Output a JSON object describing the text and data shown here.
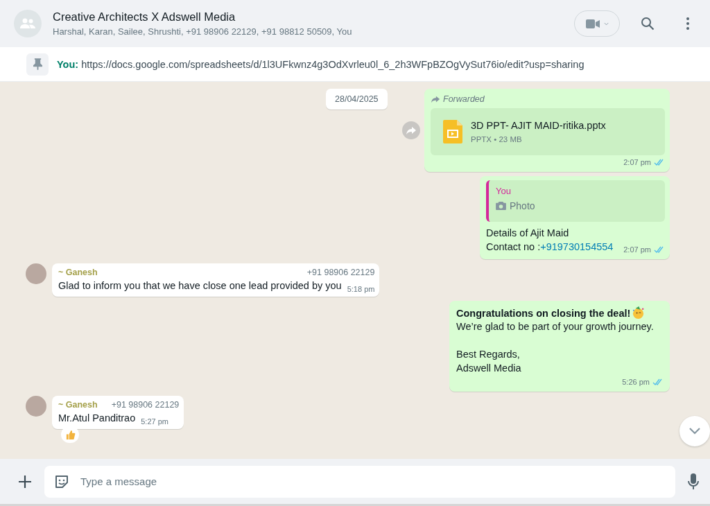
{
  "header": {
    "title": "Creative Architects X Adswell Media",
    "members": "Harshal, Karan, Sailee, Shrushti, +91 98906 22129, +91 98812 50509, You"
  },
  "pinned": {
    "sender": "You:",
    "text": "https://docs.google.com/spreadsheets/d/1l3UFkwnz4g3OdXvrleu0l_6_2h3WFpBZOgVySut76io/edit?usp=sharing"
  },
  "date_chip": "28/04/2025",
  "messages": [
    {
      "kind": "file",
      "forwarded_label": "Forwarded",
      "file_name": "3D PPT- AJIT MAID-ritika.pptx",
      "file_meta": "PPTX • 23 MB",
      "time": "2:07 pm",
      "read": true
    },
    {
      "kind": "reply",
      "quote_author": "You",
      "quote_text": "Photo",
      "text": "Details of Ajit Maid",
      "link_prefix": "Contact no :",
      "link": "+919730154554",
      "time": "2:07 pm",
      "read": true
    },
    {
      "kind": "text",
      "sender": "~ Ganesh",
      "phone": "+91 98906 22129",
      "text": "Glad to inform you that we have close one lead provided by you",
      "time": "5:18 pm",
      "reacted": false
    },
    {
      "kind": "announce",
      "headline": "Congratulations on closing the deal!",
      "body": "We’re glad to be part of your growth journey.\n\nBest Regards,\nAdswell Media",
      "time": "5:26 pm",
      "read": true
    },
    {
      "kind": "text",
      "sender": "~ Ganesh",
      "phone": "+91 98906 22129",
      "text": "Mr.Atul Panditrao",
      "time": "5:27 pm",
      "reacted": true
    }
  ],
  "composer": {
    "placeholder": "Type a message"
  }
}
